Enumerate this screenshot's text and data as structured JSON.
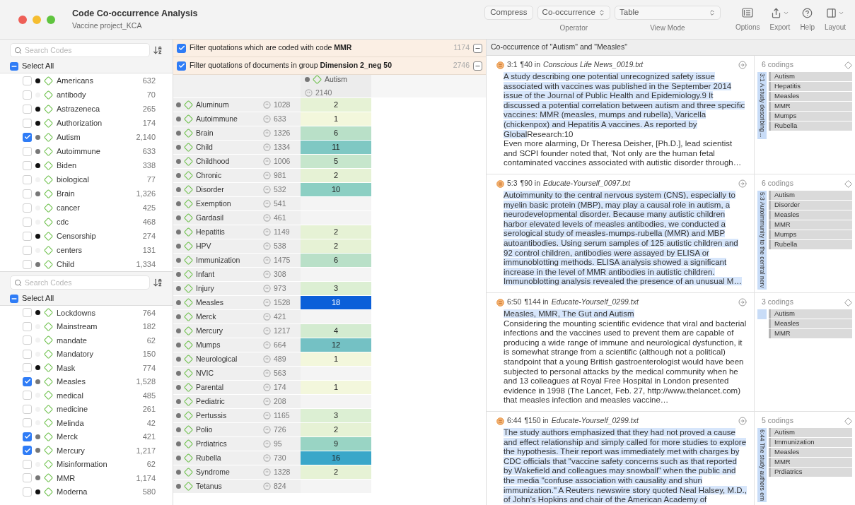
{
  "window": {
    "title": "Code Co-occurrence Analysis",
    "subtitle": "Vaccine project_KCA"
  },
  "toolbar": {
    "compress": "Compress",
    "selects": [
      {
        "value": "Co-occurrence",
        "label": "Operator",
        "wide": false
      },
      {
        "value": "Table",
        "label": "View Mode",
        "wide": true
      }
    ],
    "actions": [
      {
        "kind": "options",
        "label": "Options",
        "menu": false
      },
      {
        "kind": "export",
        "label": "Export",
        "menu": true
      },
      {
        "kind": "help",
        "label": "Help",
        "menu": false
      },
      {
        "kind": "layout",
        "label": "Layout",
        "menu": true
      }
    ]
  },
  "code_lists": [
    {
      "search_placeholder": "Search Codes",
      "select_all": {
        "label": "Select All",
        "mixed": true
      },
      "codes": [
        {
          "name": "Americans",
          "count": "632",
          "checked": false,
          "color": "#111111"
        },
        {
          "name": "antibody",
          "count": "70",
          "checked": false,
          "color": "#f2f2f2"
        },
        {
          "name": "Astrazeneca",
          "count": "265",
          "checked": false,
          "color": "#111111"
        },
        {
          "name": "Authorization",
          "count": "174",
          "checked": false,
          "color": "#111111"
        },
        {
          "name": "Autism",
          "count": "2,140",
          "checked": true,
          "color": "#777777"
        },
        {
          "name": "Autoimmune",
          "count": "633",
          "checked": false,
          "color": "#777777"
        },
        {
          "name": "Biden",
          "count": "338",
          "checked": false,
          "color": "#111111"
        },
        {
          "name": "biological",
          "count": "77",
          "checked": false,
          "color": "#f2f2f2"
        },
        {
          "name": "Brain",
          "count": "1,326",
          "checked": false,
          "color": "#777777"
        },
        {
          "name": "cancer",
          "count": "425",
          "checked": false,
          "color": "#f2f2f2"
        },
        {
          "name": "cdc",
          "count": "468",
          "checked": false,
          "color": "#f2f2f2"
        },
        {
          "name": "Censorship",
          "count": "274",
          "checked": false,
          "color": "#111111"
        },
        {
          "name": "centers",
          "count": "131",
          "checked": false,
          "color": "#f2f2f2"
        },
        {
          "name": "Child",
          "count": "1,334",
          "checked": false,
          "color": "#777777"
        }
      ]
    },
    {
      "search_placeholder": "Search Codes",
      "select_all": {
        "label": "Select All",
        "mixed": true
      },
      "codes": [
        {
          "name": "Lockdowns",
          "count": "764",
          "checked": false,
          "color": "#111111"
        },
        {
          "name": "Mainstream",
          "count": "182",
          "checked": false,
          "color": "#f2f2f2"
        },
        {
          "name": "mandate",
          "count": "62",
          "checked": false,
          "color": "#f2f2f2"
        },
        {
          "name": "Mandatory",
          "count": "150",
          "checked": false,
          "color": "#f2f2f2"
        },
        {
          "name": "Mask",
          "count": "774",
          "checked": false,
          "color": "#111111"
        },
        {
          "name": "Measles",
          "count": "1,528",
          "checked": true,
          "color": "#777777"
        },
        {
          "name": "medical",
          "count": "485",
          "checked": false,
          "color": "#f2f2f2"
        },
        {
          "name": "medicine",
          "count": "261",
          "checked": false,
          "color": "#f2f2f2"
        },
        {
          "name": "Melinda",
          "count": "42",
          "checked": false,
          "color": "#f2f2f2"
        },
        {
          "name": "Merck",
          "count": "421",
          "checked": true,
          "color": "#777777"
        },
        {
          "name": "Mercury",
          "count": "1,217",
          "checked": true,
          "color": "#777777"
        },
        {
          "name": "Misinformation",
          "count": "62",
          "checked": false,
          "color": "#f2f2f2"
        },
        {
          "name": "MMR",
          "count": "1,174",
          "checked": false,
          "color": "#777777"
        },
        {
          "name": "Moderna",
          "count": "580",
          "checked": false,
          "color": "#111111"
        }
      ]
    }
  ],
  "filters": [
    {
      "label": "Filter quotations which are coded with code **MMR**",
      "checked": true,
      "count": "1174"
    },
    {
      "label": "Filter quotations of documents in group **Dimension 2_neg 50**",
      "checked": true,
      "count": "2746"
    }
  ],
  "table": {
    "column": {
      "name": "Autism",
      "count": "2140",
      "color": "#777777"
    },
    "rows": [
      {
        "name": "Aluminum",
        "count": "1028",
        "value": "2",
        "color": "#e6f2d5"
      },
      {
        "name": "Autoimmune",
        "count": "633",
        "value": "1",
        "color": "#f3f7dc"
      },
      {
        "name": "Brain",
        "count": "1326",
        "value": "6",
        "color": "#b9e0c8"
      },
      {
        "name": "Child",
        "count": "1334",
        "value": "11",
        "color": "#7fc8c3"
      },
      {
        "name": "Childhood",
        "count": "1006",
        "value": "5",
        "color": "#c6e6cc"
      },
      {
        "name": "Chronic",
        "count": "981",
        "value": "2",
        "color": "#e6f2d5"
      },
      {
        "name": "Disorder",
        "count": "532",
        "value": "10",
        "color": "#8ccfc3"
      },
      {
        "name": "Exemption",
        "count": "541",
        "color": "#f4f4f4"
      },
      {
        "name": "Gardasil",
        "count": "461",
        "color": "#f4f4f4"
      },
      {
        "name": "Hepatitis",
        "count": "1149",
        "value": "2",
        "color": "#e6f2d5"
      },
      {
        "name": "HPV",
        "count": "538",
        "value": "2",
        "color": "#e6f2d5"
      },
      {
        "name": "Immunization",
        "count": "1475",
        "value": "6",
        "color": "#b9e0c8"
      },
      {
        "name": "Infant",
        "count": "308",
        "color": "#f4f4f4"
      },
      {
        "name": "Injury",
        "count": "973",
        "value": "3",
        "color": "#dcefd3"
      },
      {
        "name": "Measles",
        "count": "1528",
        "value": "18",
        "color": "#0b5fd9"
      },
      {
        "name": "Merck",
        "count": "421",
        "color": "#f4f4f4"
      },
      {
        "name": "Mercury",
        "count": "1217",
        "value": "4",
        "color": "#d3ebd0"
      },
      {
        "name": "Mumps",
        "count": "664",
        "value": "12",
        "color": "#74c1c4"
      },
      {
        "name": "Neurological",
        "count": "489",
        "value": "1",
        "color": "#f3f7dc"
      },
      {
        "name": "NVIC",
        "count": "563",
        "color": "#f4f4f4"
      },
      {
        "name": "Parental",
        "count": "174",
        "value": "1",
        "color": "#f3f7dc"
      },
      {
        "name": "Pediatric",
        "count": "208",
        "color": "#f4f4f4"
      },
      {
        "name": "Pertussis",
        "count": "1165",
        "value": "3",
        "color": "#dcefd3"
      },
      {
        "name": "Polio",
        "count": "726",
        "value": "2",
        "color": "#e6f2d5"
      },
      {
        "name": "Prdiatrics",
        "count": "95",
        "value": "9",
        "color": "#99d4c4"
      },
      {
        "name": "Rubella",
        "count": "730",
        "value": "16",
        "color": "#3aa7c9"
      },
      {
        "name": "Syndrome",
        "count": "1328",
        "value": "2",
        "color": "#e6f2d5"
      },
      {
        "name": "Tetanus",
        "count": "824",
        "color": "#f4f4f4"
      }
    ]
  },
  "cooccurrence": {
    "title": "Co-occurrence of \"Autism\" and \"Measles\"",
    "quotations": [
      {
        "id": "3:1",
        "location": "¶40 in",
        "document": "Conscious Life News_0019.txt",
        "highlight": "A study describing one potential unrecognized safety issue associated with vaccines was published in the September 2014 issue of the Journal of Public Health and Epidemiology.9 It discussed a potential correlation between autism and three specific vaccines: MMR (measles, mumps and rubella), Varicella (chickenpox) and Hepatitis A vaccines. As reported by Global",
        "text": "Research:10\nEven more alarming, Dr Theresa Deisher, [Ph.D.], lead scientist and SCPI founder noted that, 'Not only are the human fetal contaminated vaccines associated with autistic disorder through…",
        "strip_label": "3:1 A study describing…",
        "codings": "6 codings",
        "codes": [
          "Autism",
          "Hepatitis",
          "Measles",
          "MMR",
          "Mumps",
          "Rubella"
        ]
      },
      {
        "id": "5:3",
        "location": "¶90 in",
        "document": "Educate-Yourself_0097.txt",
        "highlight": "Autoimmunity to the central nervous system (CNS), especially to myelin basic protein (MBP), may play a causal role in autism, a neurodevelopmental disorder. Because many autistic children harbor elevated levels of measles antibodies, we conducted a serological study of measles-mumps-rubella (MMR) and MBP autoantibodies. Using serum samples of 125 autistic children and 92 control children, antibodies were assayed by ELISA or immunoblotting methods. ELISA analysis showed a significant increase in the level of MMR antibodies in autistic children. Immunoblotting analysis revealed the presence of an unusual M…",
        "strip_label": "5:3 Autoimmunity to the central nerv",
        "codings": "6 codings",
        "codes": [
          "Autism",
          "Disorder",
          "Measles",
          "MMR",
          "Mumps",
          "Rubella"
        ]
      },
      {
        "id": "6:50",
        "location": "¶144 in",
        "document": "Educate-Yourself_0299.txt",
        "highlight": "Measles, MMR, The Gut and Autism",
        "text": "\nConsidering the mounting scientific evidence that viral and bacterial infections and the vaccines used to prevent them are capable of producing a wide range of immune and neurological dysfunction, it is somewhat strange from a scientific (although not a political) standpoint that a young British gastroenterologist would have been subjected to personal attacks by the medical community when he and 13 colleagues at Royal Free Hospital in London presented evidence in 1998 (The Lancet, Feb. 27, http://www.thelancet.com) that measles infection and measles vaccine…",
        "codings": "3 codings",
        "codes": [
          "Autism",
          "Measles",
          "MMR"
        ]
      },
      {
        "id": "6:44",
        "location": "¶150 in",
        "document": "Educate-Yourself_0299.txt",
        "highlight": "The study authors emphasized that they had not proved a cause and effect relationship and simply called for more studies to explore the hypothesis. Their report was immediately met with charges by CDC officials that \"vaccine safety concerns such as that reported by Wakefield and colleagues may snowball\" when the public and the media \"confuse association with causality and shun immunization.\" A Reuters newswire story quoted Neal Halsey, M.D., of John's Hopkins and chair of the American Academy of",
        "strip_label": "6:44 The study authors em",
        "codings": "5 codings",
        "codes": [
          "Autism",
          "Immunization",
          "Measles",
          "MMR",
          "Prdiatrics"
        ]
      }
    ]
  }
}
